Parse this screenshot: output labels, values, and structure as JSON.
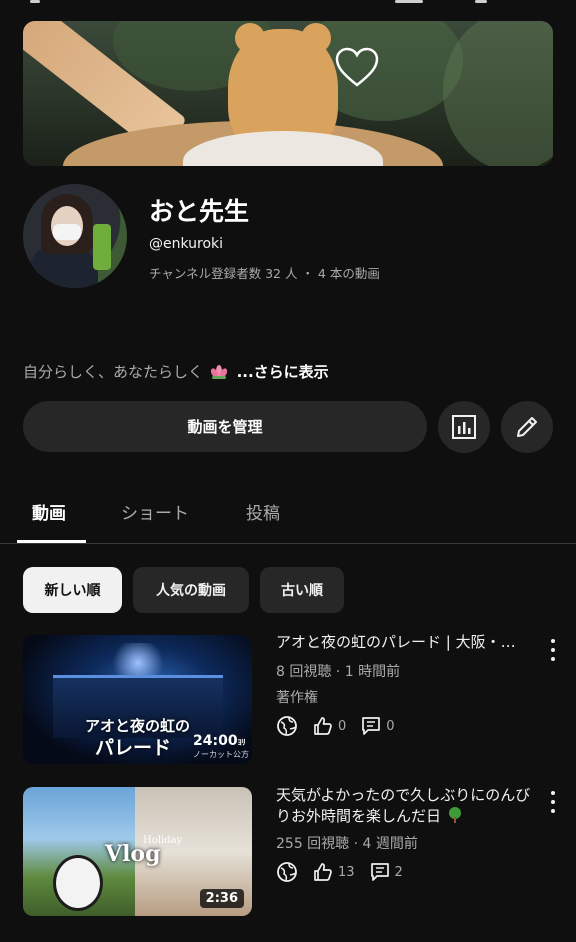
{
  "channel": {
    "name": "おと先生",
    "handle": "@enkuroki",
    "stats": "チャンネル登録者数 32 人 ・ 4 本の動画",
    "description": "自分らしく、あなたらしく",
    "more_label": "...さらに表示"
  },
  "actions": {
    "manage_label": "動画を管理",
    "analytics_icon": "analytics-icon",
    "edit_icon": "pencil-icon"
  },
  "tabs": [
    {
      "label": "動画",
      "active": true
    },
    {
      "label": "ショート",
      "active": false
    },
    {
      "label": "投稿",
      "active": false
    }
  ],
  "sort_chips": [
    {
      "label": "新しい順",
      "active": true
    },
    {
      "label": "人気の動画",
      "active": false
    },
    {
      "label": "古い順",
      "active": false
    }
  ],
  "videos": [
    {
      "title": "アオと夜の虹のパレード | 大阪・…",
      "meta": "8 回視聴 · 1 時間前",
      "extra": "著作権",
      "likes": "0",
      "comments": "0",
      "thumb_line1": "アオと夜の虹の",
      "thumb_line2": "パレード",
      "thumb_duration": "24:00",
      "thumb_duration_suffix": "ﾖﾘ",
      "thumb_sub": "ノーカット公方"
    },
    {
      "title": "天気がよかったので久しぶりにのんびりお外時間を楽しんだ日",
      "meta": "255 回視聴 · 4 週間前",
      "likes": "13",
      "comments": "2",
      "thumb_text": "Vlog",
      "thumb_sub": "Holiday",
      "duration": "2:36"
    }
  ],
  "colors": {
    "background": "#0f0f0f",
    "surface": "#272727",
    "text_primary": "#f1f1f1",
    "text_secondary": "#aaaaaa"
  }
}
